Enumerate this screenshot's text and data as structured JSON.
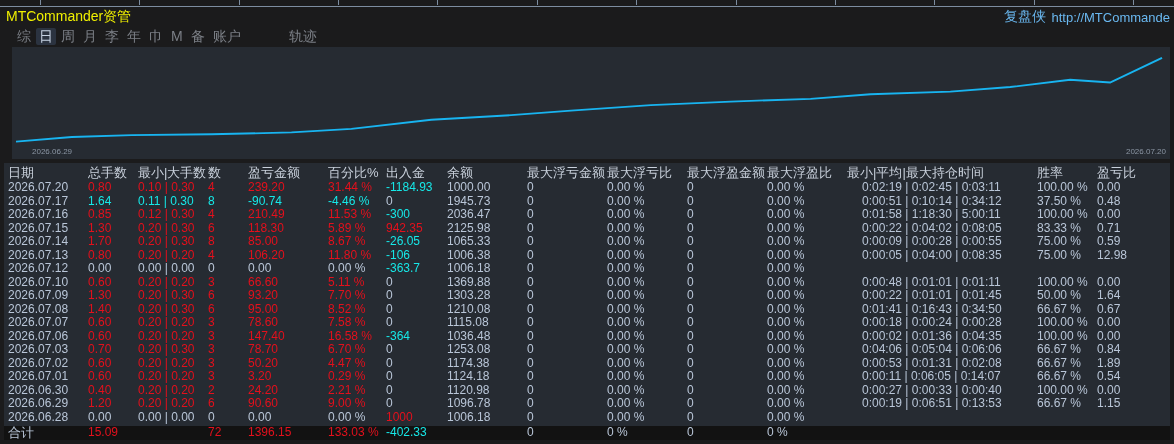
{
  "title": "MTCommander资管",
  "brand": {
    "name": "复盘侠",
    "link": "http://MTCommande"
  },
  "tabs": [
    {
      "label": "综",
      "selected": false
    },
    {
      "label": "日",
      "selected": true
    },
    {
      "label": "周",
      "selected": false
    },
    {
      "label": "月",
      "selected": false
    },
    {
      "label": "李",
      "selected": false
    },
    {
      "label": "年",
      "selected": false
    },
    {
      "label": "巾",
      "selected": false
    },
    {
      "label": "M",
      "selected": false
    },
    {
      "label": "备",
      "selected": false
    },
    {
      "label": "账户",
      "selected": false
    },
    {
      "label": "轨迹",
      "selected": false
    }
  ],
  "chart": {
    "start_label": "2026.06.29",
    "end_label": "2026.07.20"
  },
  "table": {
    "columns": [
      "日期",
      "总手数",
      "最小|大手数",
      "数",
      "盈亏金额",
      "百分比%",
      "出入金",
      "余额",
      "最大浮亏金额",
      "最大浮亏比",
      "最大浮盈金额",
      "最大浮盈比",
      "最小|平均|最大持仓时间",
      "胜率",
      "盈亏比"
    ],
    "rows": [
      {
        "date": "2026.07.20",
        "color": "#e4101c",
        "total": "0.80",
        "minmax": "0.10 | 0.30",
        "count": "4",
        "pnl": "239.20",
        "pct": "31.44 %",
        "cash": {
          "value": "-1184.93",
          "color": "#16e8e8"
        },
        "balance": "1000.00",
        "mfl": "0",
        "mflp": "0.00 %",
        "mfp": "0",
        "mfpp": "0.00 %",
        "times": "0:02:19 | 0:02:45 | 0:03:11",
        "win": "100.00 %",
        "ratio": "0.00"
      },
      {
        "date": "2026.07.17",
        "color": "#16e8e8",
        "total": "1.64",
        "minmax": "0.11 | 0.30",
        "count": "8",
        "pnl": "-90.74",
        "pct": "-4.46 %",
        "cash": {
          "value": "0",
          "color": "#b9c6d8"
        },
        "balance": "1945.73",
        "mfl": "0",
        "mflp": "0.00 %",
        "mfp": "0",
        "mfpp": "0.00 %",
        "times": "0:00:51 | 0:10:14 | 0:34:12",
        "win": "37.50 %",
        "ratio": "0.48"
      },
      {
        "date": "2026.07.16",
        "color": "#e4101c",
        "total": "0.85",
        "minmax": "0.12 | 0.30",
        "count": "4",
        "pnl": "210.49",
        "pct": "11.53 %",
        "cash": {
          "value": "-300",
          "color": "#16e8e8"
        },
        "balance": "2036.47",
        "mfl": "0",
        "mflp": "0.00 %",
        "mfp": "0",
        "mfpp": "0.00 %",
        "times": "0:01:58 | 1:18:30 | 5:00:11",
        "win": "100.00 %",
        "ratio": "0.00"
      },
      {
        "date": "2026.07.15",
        "color": "#e4101c",
        "total": "1.30",
        "minmax": "0.20 | 0.30",
        "count": "6",
        "pnl": "118.30",
        "pct": "5.89 %",
        "cash": {
          "value": "942.35",
          "color": "#e4101c"
        },
        "balance": "2125.98",
        "mfl": "0",
        "mflp": "0.00 %",
        "mfp": "0",
        "mfpp": "0.00 %",
        "times": "0:00:22 | 0:04:02 | 0:08:05",
        "win": "83.33 %",
        "ratio": "0.71"
      },
      {
        "date": "2026.07.14",
        "color": "#e4101c",
        "total": "1.70",
        "minmax": "0.20 | 0.30",
        "count": "8",
        "pnl": "85.00",
        "pct": "8.67 %",
        "cash": {
          "value": "-26.05",
          "color": "#16e8e8"
        },
        "balance": "1065.33",
        "mfl": "0",
        "mflp": "0.00 %",
        "mfp": "0",
        "mfpp": "0.00 %",
        "times": "0:00:09 | 0:00:28 | 0:00:55",
        "win": "75.00 %",
        "ratio": "0.59"
      },
      {
        "date": "2026.07.13",
        "color": "#e4101c",
        "total": "0.80",
        "minmax": "0.20 | 0.20",
        "count": "4",
        "pnl": "106.20",
        "pct": "11.80 %",
        "cash": {
          "value": "-106",
          "color": "#16e8e8"
        },
        "balance": "1006.38",
        "mfl": "0",
        "mflp": "0.00 %",
        "mfp": "0",
        "mfpp": "0.00 %",
        "times": "0:00:05 | 0:04:00 | 0:08:35",
        "win": "75.00 %",
        "ratio": "12.98"
      },
      {
        "date": "2026.07.12",
        "color": "#b9c6d8",
        "total": "0.00",
        "minmax": "0.00 | 0.00",
        "count": "0",
        "pnl": "0.00",
        "pct": "0.00 %",
        "cash": {
          "value": "-363.7",
          "color": "#16e8e8"
        },
        "balance": "1006.18",
        "mfl": "0",
        "mflp": "0.00 %",
        "mfp": "0",
        "mfpp": "0.00 %"
      },
      {
        "date": "2026.07.10",
        "color": "#e4101c",
        "total": "0.60",
        "minmax": "0.20 | 0.20",
        "count": "3",
        "pnl": "66.60",
        "pct": "5.11 %",
        "cash": {
          "value": "0",
          "color": "#b9c6d8"
        },
        "balance": "1369.88",
        "mfl": "0",
        "mflp": "0.00 %",
        "mfp": "0",
        "mfpp": "0.00 %",
        "times": "0:00:48 | 0:01:01 | 0:01:11",
        "win": "100.00 %",
        "ratio": "0.00"
      },
      {
        "date": "2026.07.09",
        "color": "#e4101c",
        "total": "1.30",
        "minmax": "0.20 | 0.30",
        "count": "6",
        "pnl": "93.20",
        "pct": "7.70 %",
        "cash": {
          "value": "0",
          "color": "#b9c6d8"
        },
        "balance": "1303.28",
        "mfl": "0",
        "mflp": "0.00 %",
        "mfp": "0",
        "mfpp": "0.00 %",
        "times": "0:00:22 | 0:01:01 | 0:01:45",
        "win": "50.00 %",
        "ratio": "1.64"
      },
      {
        "date": "2026.07.08",
        "color": "#e4101c",
        "total": "1.40",
        "minmax": "0.20 | 0.30",
        "count": "6",
        "pnl": "95.00",
        "pct": "8.52 %",
        "cash": {
          "value": "0",
          "color": "#b9c6d8"
        },
        "balance": "1210.08",
        "mfl": "0",
        "mflp": "0.00 %",
        "mfp": "0",
        "mfpp": "0.00 %",
        "times": "0:01:41 | 0:16:43 | 0:34:50",
        "win": "66.67 %",
        "ratio": "0.67"
      },
      {
        "date": "2026.07.07",
        "color": "#e4101c",
        "total": "0.60",
        "minmax": "0.20 | 0.20",
        "count": "3",
        "pnl": "78.60",
        "pct": "7.58 %",
        "cash": {
          "value": "0",
          "color": "#b9c6d8"
        },
        "balance": "1115.08",
        "mfl": "0",
        "mflp": "0.00 %",
        "mfp": "0",
        "mfpp": "0.00 %",
        "times": "0:00:18 | 0:00:24 | 0:00:28",
        "win": "100.00 %",
        "ratio": "0.00"
      },
      {
        "date": "2026.07.06",
        "color": "#e4101c",
        "total": "0.60",
        "minmax": "0.20 | 0.20",
        "count": "3",
        "pnl": "147.40",
        "pct": "16.58 %",
        "cash": {
          "value": "-364",
          "color": "#16e8e8"
        },
        "balance": "1036.48",
        "mfl": "0",
        "mflp": "0.00 %",
        "mfp": "0",
        "mfpp": "0.00 %",
        "times": "0:00:02 | 0:01:36 | 0:04:35",
        "win": "100.00 %",
        "ratio": "0.00"
      },
      {
        "date": "2026.07.03",
        "color": "#e4101c",
        "total": "0.70",
        "minmax": "0.20 | 0.30",
        "count": "3",
        "pnl": "78.70",
        "pct": "6.70 %",
        "cash": {
          "value": "0",
          "color": "#b9c6d8"
        },
        "balance": "1253.08",
        "mfl": "0",
        "mflp": "0.00 %",
        "mfp": "0",
        "mfpp": "0.00 %",
        "times": "0:04:06 | 0:05:04 | 0:06:06",
        "win": "66.67 %",
        "ratio": "0.84"
      },
      {
        "date": "2026.07.02",
        "color": "#e4101c",
        "total": "0.60",
        "minmax": "0.20 | 0.20",
        "count": "3",
        "pnl": "50.20",
        "pct": "4.47 %",
        "cash": {
          "value": "0",
          "color": "#b9c6d8"
        },
        "balance": "1174.38",
        "mfl": "0",
        "mflp": "0.00 %",
        "mfp": "0",
        "mfpp": "0.00 %",
        "times": "0:00:53 | 0:01:31 | 0:02:08",
        "win": "66.67 %",
        "ratio": "1.89"
      },
      {
        "date": "2026.07.01",
        "color": "#e4101c",
        "total": "0.60",
        "minmax": "0.20 | 0.20",
        "count": "3",
        "pnl": "3.20",
        "pct": "0.29 %",
        "cash": {
          "value": "0",
          "color": "#b9c6d8"
        },
        "balance": "1124.18",
        "mfl": "0",
        "mflp": "0.00 %",
        "mfp": "0",
        "mfpp": "0.00 %",
        "times": "0:00:11 | 0:06:05 | 0:14:07",
        "win": "66.67 %",
        "ratio": "0.54"
      },
      {
        "date": "2026.06.30",
        "color": "#e4101c",
        "total": "0.40",
        "minmax": "0.20 | 0.20",
        "count": "2",
        "pnl": "24.20",
        "pct": "2.21 %",
        "cash": {
          "value": "0",
          "color": "#b9c6d8"
        },
        "balance": "1120.98",
        "mfl": "0",
        "mflp": "0.00 %",
        "mfp": "0",
        "mfpp": "0.00 %",
        "times": "0:00:27 | 0:00:33 | 0:00:40",
        "win": "100.00 %",
        "ratio": "0.00"
      },
      {
        "date": "2026.06.29",
        "color": "#e4101c",
        "total": "1.20",
        "minmax": "0.20 | 0.20",
        "count": "6",
        "pnl": "90.60",
        "pct": "9.00 %",
        "cash": {
          "value": "0",
          "color": "#b9c6d8"
        },
        "balance": "1096.78",
        "mfl": "0",
        "mflp": "0.00 %",
        "mfp": "0",
        "mfpp": "0.00 %",
        "times": "0:00:19 | 0:06:51 | 0:13:53",
        "win": "66.67 %",
        "ratio": "1.15"
      },
      {
        "date": "2026.06.28",
        "color": "#b9c6d8",
        "total": "0.00",
        "minmax": "0.00 | 0.00",
        "count": "0",
        "pnl": "0.00",
        "pct": "0.00 %",
        "cash": {
          "value": "1000",
          "color": "#e4101c"
        },
        "balance": "1006.18",
        "mfl": "0",
        "mflp": "0.00 %",
        "mfp": "0",
        "mfpp": "0.00 %"
      }
    ],
    "total": {
      "date": "合计",
      "color": "#e4101c",
      "total": "15.09",
      "count": "72",
      "pnl": "1396.15",
      "pct": "133.03 %",
      "cash": {
        "value": "-402.33",
        "color": "#16e8e8"
      },
      "mfl": "0",
      "mflp": "0 %",
      "mfp": "0",
      "mfpp": "0 %"
    }
  }
}
